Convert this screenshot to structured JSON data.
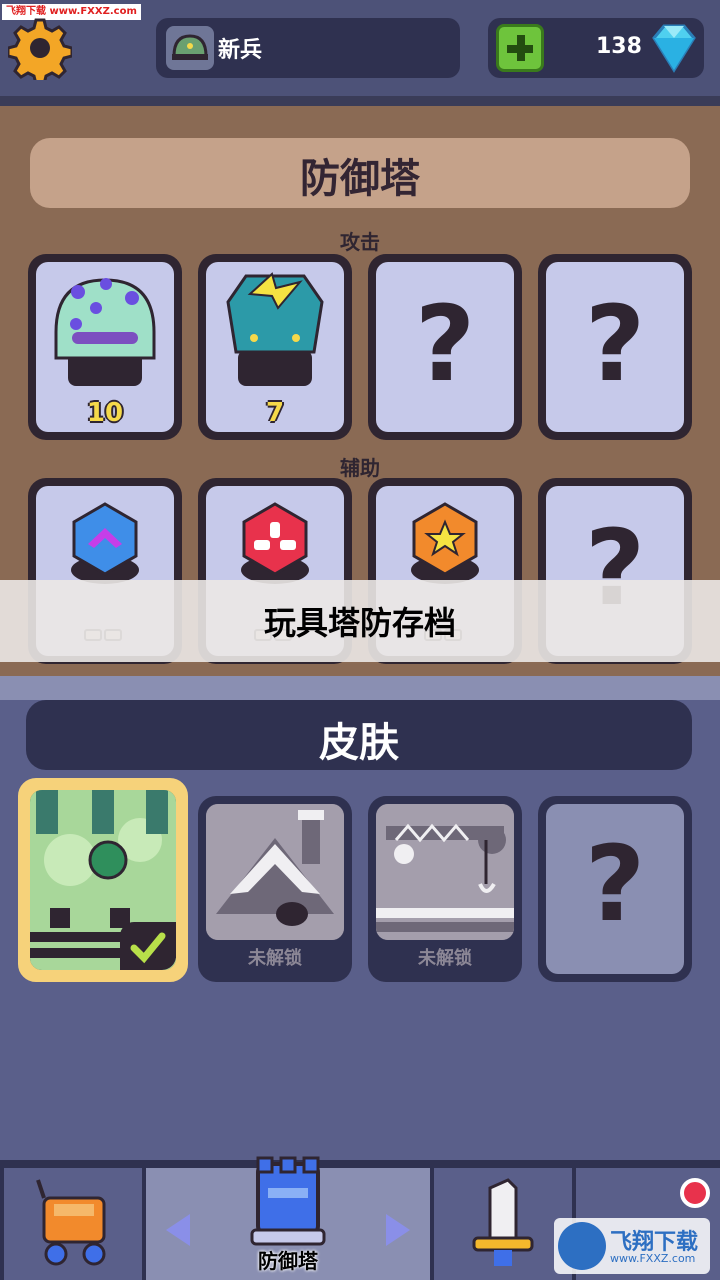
{
  "watermark_top": "飞翔下载 www.FXXZ.com",
  "header": {
    "rank_label": "新兵",
    "gem_count": "138"
  },
  "towers": {
    "title": "防御塔",
    "attack_label": "攻击",
    "support_label": "辅助",
    "attack": [
      {
        "name": "poison-tower",
        "count": "10",
        "locked": false
      },
      {
        "name": "lightning-tower",
        "count": "7",
        "locked": false
      },
      {
        "name": "unknown",
        "mark": "?",
        "locked": true
      },
      {
        "name": "unknown",
        "mark": "?",
        "locked": true
      }
    ],
    "support": [
      {
        "name": "blue-support",
        "locked": false
      },
      {
        "name": "red-support",
        "locked": false
      },
      {
        "name": "orange-support",
        "locked": false
      },
      {
        "name": "unknown",
        "mark": "?",
        "locked": true
      }
    ]
  },
  "banner_text": "玩具塔防存档",
  "skins": {
    "title": "皮肤",
    "items": [
      {
        "label": "",
        "selected": true
      },
      {
        "label": "未解锁",
        "selected": false
      },
      {
        "label": "未解锁",
        "selected": false
      },
      {
        "label": "",
        "mark": "?",
        "selected": false
      }
    ]
  },
  "bottom_nav": {
    "center_label": "防御塔"
  },
  "watermark_bottom": {
    "text": "飞翔下载",
    "url": "www.FXXZ.com"
  },
  "colors": {
    "top_bar": "#4d5278",
    "tower_panel": "#8a6a54",
    "card_bg": "#c6c9ea",
    "accent_yellow": "#f5d94a",
    "selected_border": "#f6d27a"
  }
}
